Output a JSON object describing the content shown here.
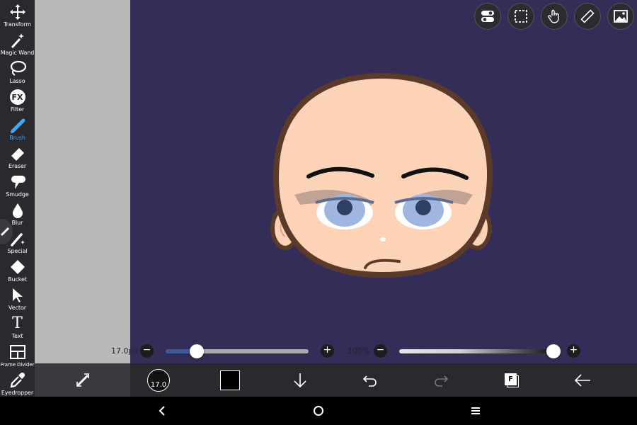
{
  "toolbar": {
    "tools": [
      {
        "label": "Transform",
        "icon": "move-arrows-icon"
      },
      {
        "label": "Magic Wand",
        "icon": "magic-wand-icon"
      },
      {
        "label": "Lasso",
        "icon": "lasso-icon"
      },
      {
        "label": "Filter",
        "icon": "fx-icon"
      },
      {
        "label": "Brush",
        "icon": "brush-icon",
        "active": true
      },
      {
        "label": "Eraser",
        "icon": "eraser-icon"
      },
      {
        "label": "Smudge",
        "icon": "smudge-icon"
      },
      {
        "label": "Blur",
        "icon": "drop-icon"
      },
      {
        "label": "Special",
        "icon": "special-brush-icon"
      },
      {
        "label": "Bucket",
        "icon": "bucket-icon"
      },
      {
        "label": "Vector",
        "icon": "pointer-icon"
      },
      {
        "label": "Text",
        "icon": "text-icon"
      },
      {
        "label": "Frame Divider",
        "icon": "frame-divider-icon"
      },
      {
        "label": "Eyedropper",
        "icon": "eyedropper-icon"
      }
    ],
    "fx_text": "FX",
    "text_glyph": "T"
  },
  "sliders": {
    "brush_size_label": "17.0px",
    "brush_size_fraction": 0.22,
    "opacity_label": "100%",
    "opacity_fraction": 1.0,
    "minus": "−",
    "plus": "+"
  },
  "bottombar": {
    "brush_size_value": "17.0",
    "color": "#000000",
    "layer_letter": "F"
  },
  "colors": {
    "canvas": "#332d57",
    "accent": "#3fa9ff",
    "skin": "#fdd3b8",
    "outline": "#5c3a2a",
    "eyes": "#9fb7e0"
  }
}
